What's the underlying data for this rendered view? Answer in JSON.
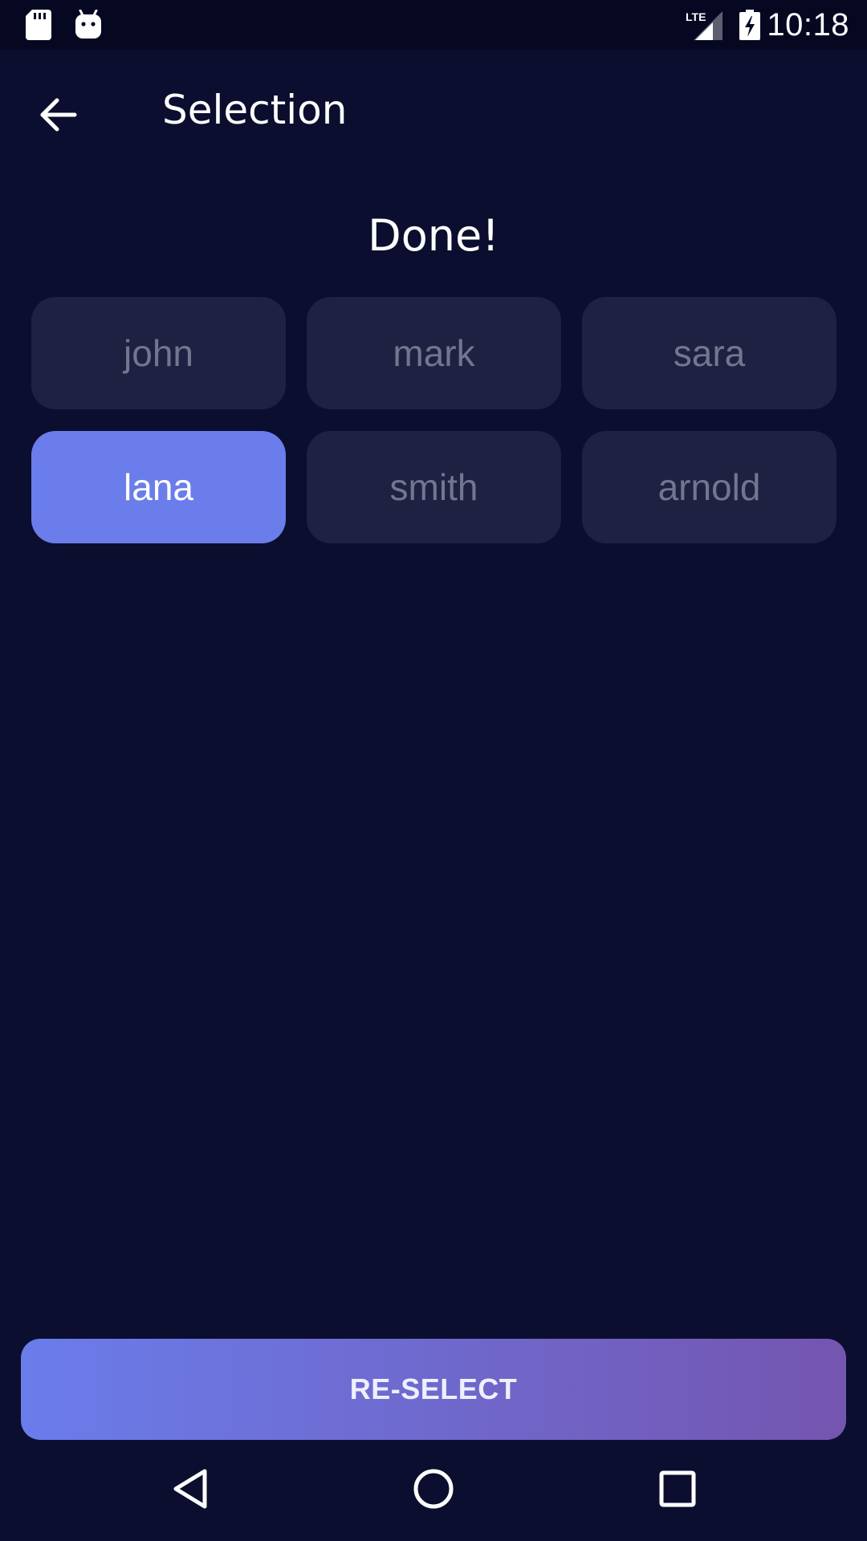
{
  "status_bar": {
    "time": "10:18",
    "network": "LTE"
  },
  "app_bar": {
    "title": "Selection"
  },
  "heading": "Done!",
  "chips": [
    {
      "label": "john",
      "selected": false
    },
    {
      "label": "mark",
      "selected": false
    },
    {
      "label": "sara",
      "selected": false
    },
    {
      "label": "lana",
      "selected": true
    },
    {
      "label": "smith",
      "selected": false
    },
    {
      "label": "arnold",
      "selected": false
    }
  ],
  "actions": {
    "reselect_label": "RE-SELECT"
  },
  "icons": {
    "sd_card": "sd-card-icon",
    "android": "android-icon",
    "signal": "lte-signal-icon",
    "battery": "battery-charging-icon",
    "back": "arrow-left-icon",
    "nav_back": "triangle-back-icon",
    "nav_home": "circle-home-icon",
    "nav_recents": "square-recents-icon"
  },
  "colors": {
    "background": "#0b0e2e",
    "status_bar": "#060822",
    "chip": "#1e2142",
    "chip_text": "#73768f",
    "chip_selected": "#6a7deb",
    "gradient_start": "#6a7deb",
    "gradient_end": "#7455b0"
  }
}
